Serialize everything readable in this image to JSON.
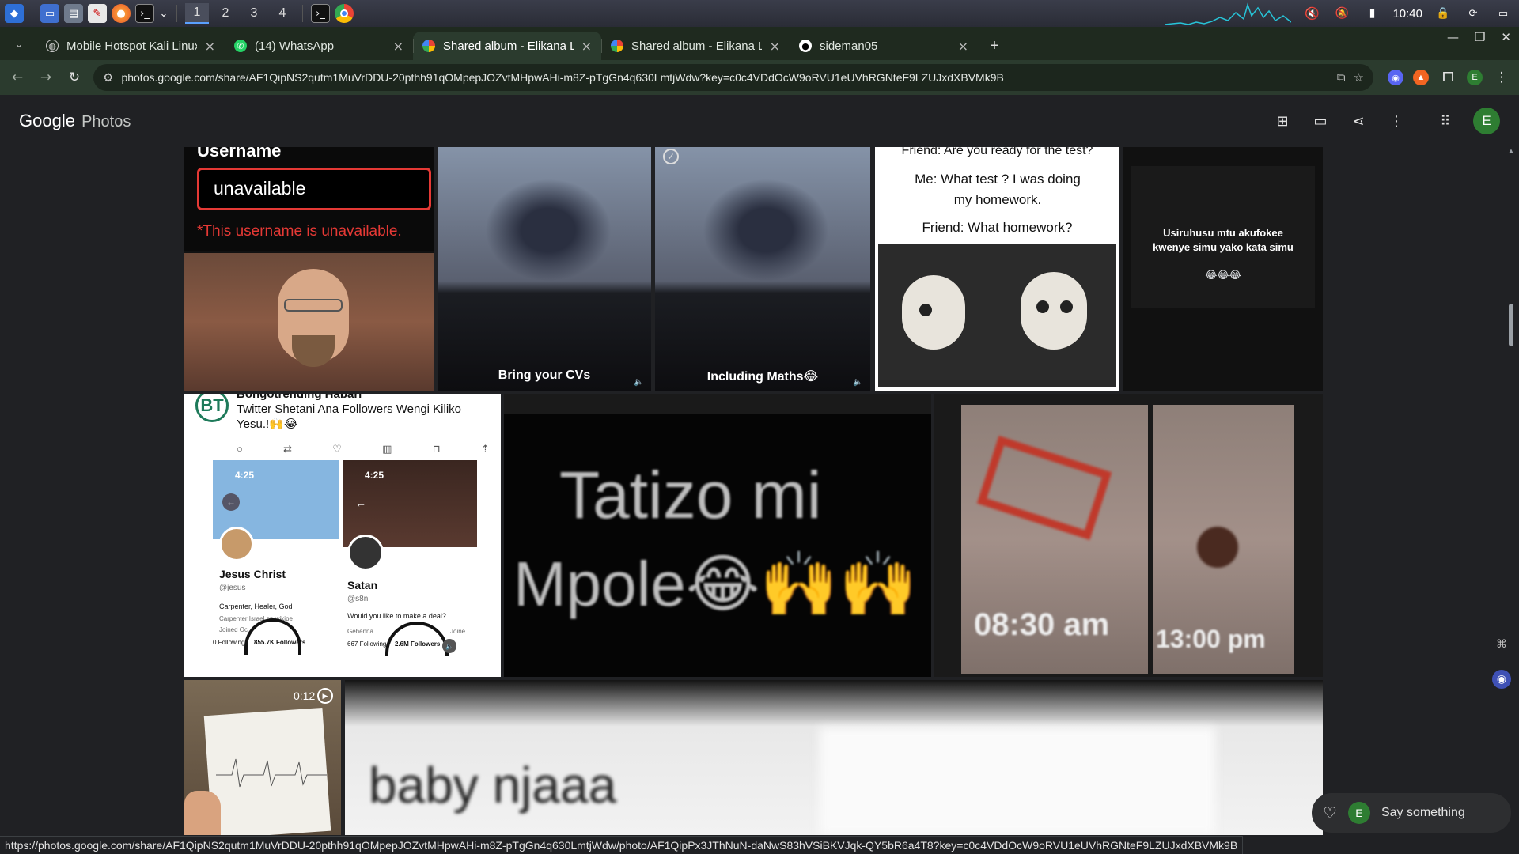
{
  "taskbar": {
    "workspaces": [
      "1",
      "2",
      "3",
      "4"
    ],
    "clock": "10:40"
  },
  "browser": {
    "tabs": [
      {
        "title": "Mobile Hotspot Kali Linux",
        "favicon": "globe-icon"
      },
      {
        "title": "(14) WhatsApp",
        "favicon": "whatsapp-icon"
      },
      {
        "title": "Shared album - Elikana L",
        "favicon": "google-photos-icon"
      },
      {
        "title": "Shared album - Elikana L",
        "favicon": "google-photos-icon"
      },
      {
        "title": "sideman05",
        "favicon": "github-icon"
      }
    ],
    "url": "photos.google.com/share/AF1QipNS2qutm1MuVrDDU-20pthh91qOMpepJOZvtMHpwAHi-m8Z-pTgGn4q630LmtjWdw?key=c0c4VDdOcW9oRVU1eUVhRGNteF9LZUJxdXBVMk9B",
    "profile_initial": "E"
  },
  "photos": {
    "brand": "Google",
    "brand_sub": "Photos",
    "avatar_initial": "E"
  },
  "tiles": {
    "username_label": "Username",
    "username_value": "unavailable",
    "username_error": "*This username is unavailable.",
    "cv_caption": "Bring your CVs",
    "maths_caption": "Including Maths😂",
    "friend_l1": "Friend: Are you ready for the test?",
    "friend_l2": "Me: What test ? I was doing my homework.",
    "friend_l3": "Friend: What homework?",
    "swahili_text": "Usiruhusu mtu akufokee kwenye simu yako kata simu",
    "swahili_emoji": "😂😂😂",
    "tweet_author": "Bongotrending Habari",
    "tweet_text": "Twitter Shetani Ana Followers Wengi Kiliko Yesu.!🙌😂",
    "jesus_time": "4:25",
    "jesus_name": "Jesus Christ",
    "jesus_handle": "@jesus",
    "jesus_bio": "Carpenter, Healer, God",
    "jesus_meta": "Carpenter  Israel  en.wikipe",
    "jesus_joined": "Joined Oc",
    "jesus_following": "0 Following",
    "jesus_followers": "855.7K Followers",
    "satan_time": "4:25",
    "satan_name": "Satan",
    "satan_handle": "@s8n",
    "satan_bio": "Would you like to make a deal?",
    "satan_meta": "Gehenna  ",
    "satan_joined": "Joine",
    "satan_following": "667 Following",
    "satan_followers": "2.6M Followers",
    "tatizo_line1": "Tatizo mi",
    "tatizo_line2": "Mpole😂🙌🙌",
    "time_am": "08:30 am",
    "time_pm": "13:00 pm",
    "video_duration": "0:12",
    "baby_text": "baby njaaa"
  },
  "comment": {
    "initial": "E",
    "placeholder": "Say something"
  },
  "status_url": "https://photos.google.com/share/AF1QipNS2qutm1MuVrDDU-20pthh91qOMpepJOZvtMHpwAHi-m8Z-pTgGn4q630LmtjWdw/photo/AF1QipPx3JThNuN-daNwS83hVSiBKVJqk-QY5bR6a4T8?key=c0c4VDdOcW9oRVU1eUVhRGNteF9LZUJxdXBVMk9B",
  "colors": {
    "tab_strip": "#1f2a1f",
    "toolbar": "#2b3b2e",
    "photos_bg": "#202124",
    "avatar": "#2e7d32",
    "error_red": "#e53935"
  }
}
